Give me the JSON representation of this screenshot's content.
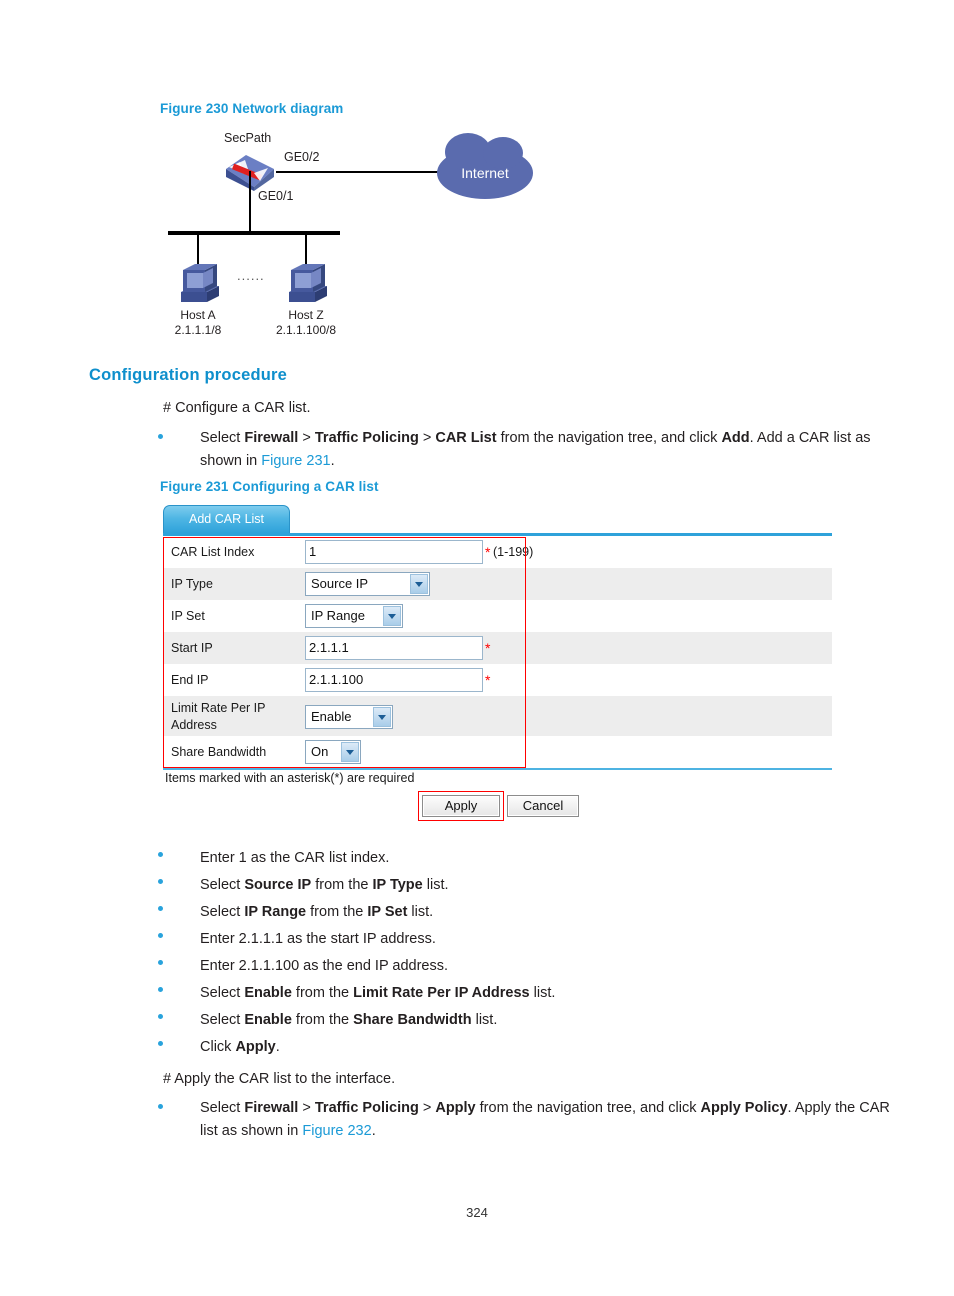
{
  "figure230": {
    "caption": "Figure 230 Network diagram",
    "device_label": "SecPath",
    "iface_top": "GE0/2",
    "iface_bottom": "GE0/1",
    "cloud_label": "Internet",
    "host_a_name": "Host A",
    "host_a_addr": "2.1.1.1/8",
    "host_z_name": "Host Z",
    "host_z_addr": "2.1.1.100/8",
    "ellipsis": "......"
  },
  "section": {
    "heading": "Configuration procedure",
    "comment1": "# Configure a CAR list.",
    "comment2": "# Apply the CAR list to the interface."
  },
  "step1": {
    "line1_a": "Select ",
    "line1_b": "Firewall",
    "line1_c": " > ",
    "line1_d": "Traffic Policing",
    "line1_e": " > ",
    "line1_f": "CAR List",
    "line1_g": " from the navigation tree, and click ",
    "line1_h": "Add",
    "line1_i": ". Add a CAR list",
    "line2_a": "as shown in ",
    "line2_b": "Figure 231",
    "line2_c": "."
  },
  "figure231": {
    "caption": "Figure 231 Configuring a CAR list",
    "tab_label": "Add CAR List",
    "rows": [
      {
        "label": "CAR List Index",
        "control": "input",
        "value": "1",
        "required": true,
        "hint": "(1-199)"
      },
      {
        "label": "IP Type",
        "control": "select",
        "value": "Source IP",
        "required": false,
        "hint": ""
      },
      {
        "label": "IP Set",
        "control": "select",
        "value": "IP Range",
        "required": false,
        "hint": ""
      },
      {
        "label": "Start IP",
        "control": "input",
        "value": "2.1.1.1",
        "required": true,
        "hint": ""
      },
      {
        "label": "End IP",
        "control": "input",
        "value": "2.1.1.100",
        "required": true,
        "hint": ""
      },
      {
        "label": "Limit Rate Per IP\nAddress",
        "control": "select",
        "value": "Enable",
        "required": false,
        "hint": ""
      },
      {
        "label": "Share Bandwidth",
        "control": "select",
        "value": "On",
        "required": false,
        "hint": ""
      }
    ],
    "asterisk_note": "Items marked with an asterisk(*) are required",
    "apply_label": "Apply",
    "cancel_label": "Cancel"
  },
  "steps": [
    {
      "plain": "Enter 1 as the CAR list index."
    },
    {
      "a": "Select ",
      "b": "Source IP",
      "c": " from the ",
      "d": "IP Type",
      "e": " list."
    },
    {
      "a": "Select ",
      "b": "IP Range",
      "c": " from the ",
      "d": "IP Set",
      "e": " list."
    },
    {
      "plain": "Enter 2.1.1.1 as the start IP address."
    },
    {
      "plain": "Enter 2.1.1.100 as the end IP address."
    },
    {
      "a": "Select ",
      "b": "Enable",
      "c": " from the ",
      "d": "Limit Rate Per IP Address",
      "e": " list."
    },
    {
      "a": "Select ",
      "b": "Enable",
      "c": " from the ",
      "d": "Share Bandwidth",
      "e": " list."
    },
    {
      "a": "Click ",
      "b": "Apply",
      "c": "."
    }
  ],
  "step_apply": {
    "l1_a": "Select ",
    "l1_b": "Firewall",
    "l1_c": " > ",
    "l1_d": "Traffic Policing",
    "l1_e": " > ",
    "l1_f": "Apply",
    "l1_g": " from the navigation tree, and click ",
    "l1_h": "Apply Policy",
    "l1_i": ". Apply the",
    "l2_a": "CAR list as shown in ",
    "l2_b": "Figure 232",
    "l2_c": "."
  },
  "page_number": "324",
  "colors": {
    "heading_blue": "#1b9ad6",
    "link_blue": "#1b9ad6",
    "bullet_blue": "#29a3dc",
    "cloud_blue": "#5a6bae",
    "required_red": "#ff0000",
    "tab_blue": "#2ea2da"
  }
}
